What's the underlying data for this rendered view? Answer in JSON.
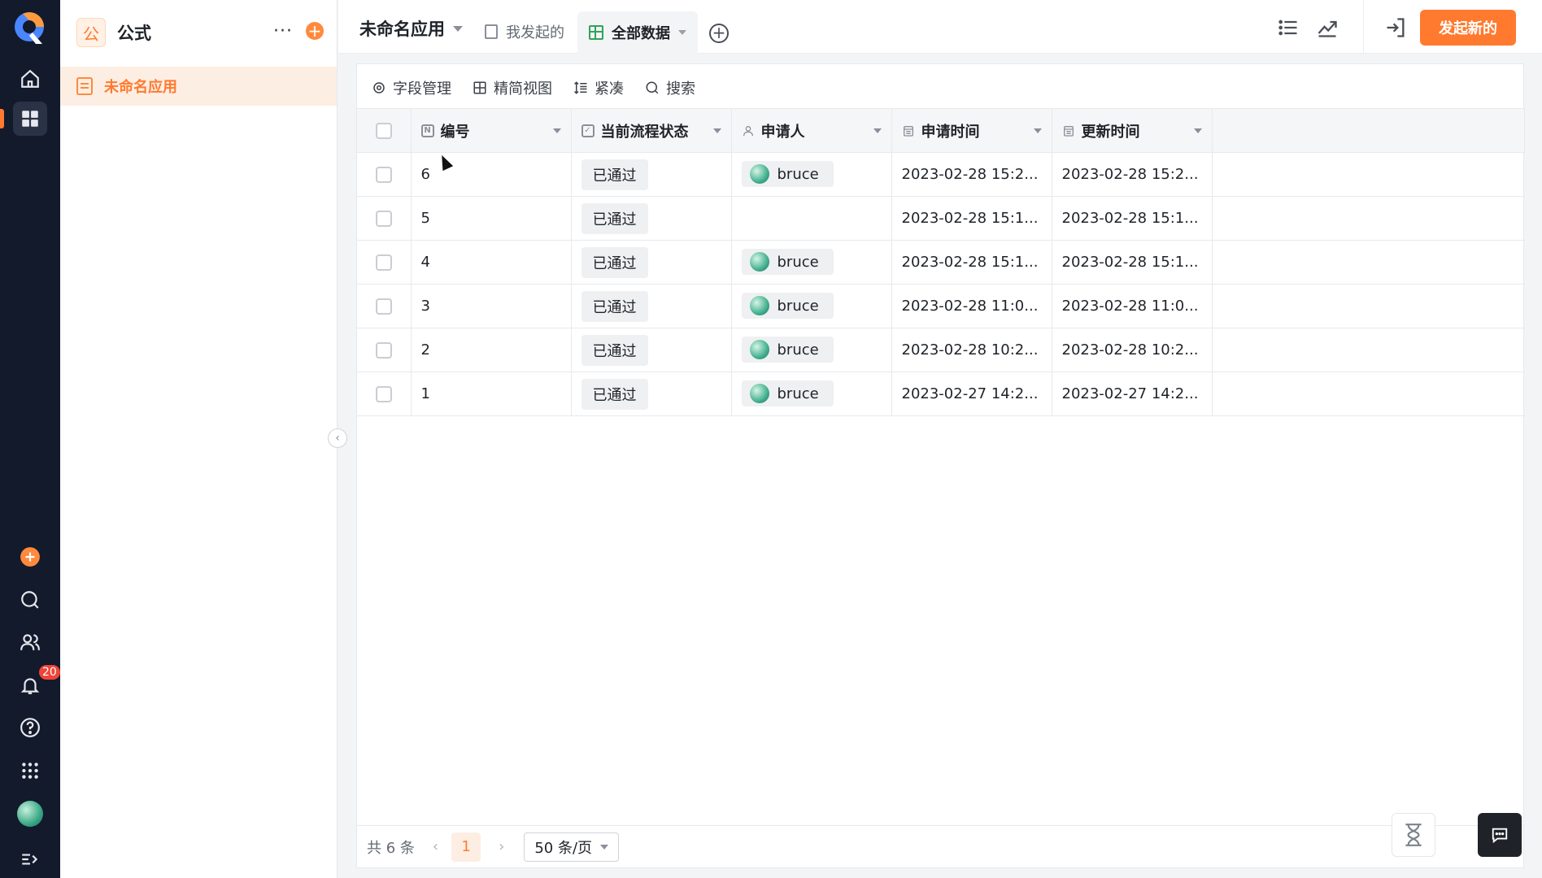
{
  "sidebar": {
    "app_icon_text": "公",
    "app_name": "公式",
    "more_label": "···",
    "add_label": "+",
    "items": [
      {
        "label": "未命名应用"
      }
    ]
  },
  "rail": {
    "notification_count": "20",
    "icons": [
      "home-icon",
      "apps-grid-icon",
      "add-circle-icon",
      "search-icon",
      "contacts-icon",
      "bell-icon",
      "help-icon",
      "app-launcher-icon",
      "avatar",
      "expand-icon"
    ]
  },
  "header": {
    "app_title": "未命名应用",
    "tabs": [
      {
        "label": "我发起的",
        "active": false
      },
      {
        "label": "全部数据",
        "active": true
      }
    ],
    "add_tab_label": "+",
    "primary_button": "发起新的"
  },
  "toolbar": {
    "items": [
      {
        "label": "字段管理",
        "icon": "gear-icon"
      },
      {
        "label": "精简视图",
        "icon": "layout-icon"
      },
      {
        "label": "紧凑",
        "icon": "row-height-icon"
      },
      {
        "label": "搜索",
        "icon": "search-icon"
      }
    ]
  },
  "table": {
    "columns": [
      {
        "label": "编号",
        "icon": "N"
      },
      {
        "label": "当前流程状态",
        "icon": "check"
      },
      {
        "label": "申请人",
        "icon": "user"
      },
      {
        "label": "申请时间",
        "icon": "calendar"
      },
      {
        "label": "更新时间",
        "icon": "calendar"
      }
    ],
    "rows": [
      {
        "id": "6",
        "status": "已通过",
        "applicant": "bruce",
        "applied": "2023-02-28 15:2...",
        "updated": "2023-02-28 15:2..."
      },
      {
        "id": "5",
        "status": "已通过",
        "applicant": "",
        "applied": "2023-02-28 15:1...",
        "updated": "2023-02-28 15:1..."
      },
      {
        "id": "4",
        "status": "已通过",
        "applicant": "bruce",
        "applied": "2023-02-28 15:1...",
        "updated": "2023-02-28 15:1..."
      },
      {
        "id": "3",
        "status": "已通过",
        "applicant": "bruce",
        "applied": "2023-02-28 11:0...",
        "updated": "2023-02-28 11:0..."
      },
      {
        "id": "2",
        "status": "已通过",
        "applicant": "bruce",
        "applied": "2023-02-28 10:2...",
        "updated": "2023-02-28 10:2..."
      },
      {
        "id": "1",
        "status": "已通过",
        "applicant": "bruce",
        "applied": "2023-02-27 14:2...",
        "updated": "2023-02-27 14:2..."
      }
    ]
  },
  "footer": {
    "total_label": "共 6 条",
    "prev": "‹",
    "current_page": "1",
    "next": "›",
    "page_size": "50 条/页"
  },
  "colors": {
    "accent": "#ff7a2f",
    "rail_bg": "#131a2c",
    "active_item_bg": "#fdeee3",
    "grid_icon": "#2fa45a"
  }
}
